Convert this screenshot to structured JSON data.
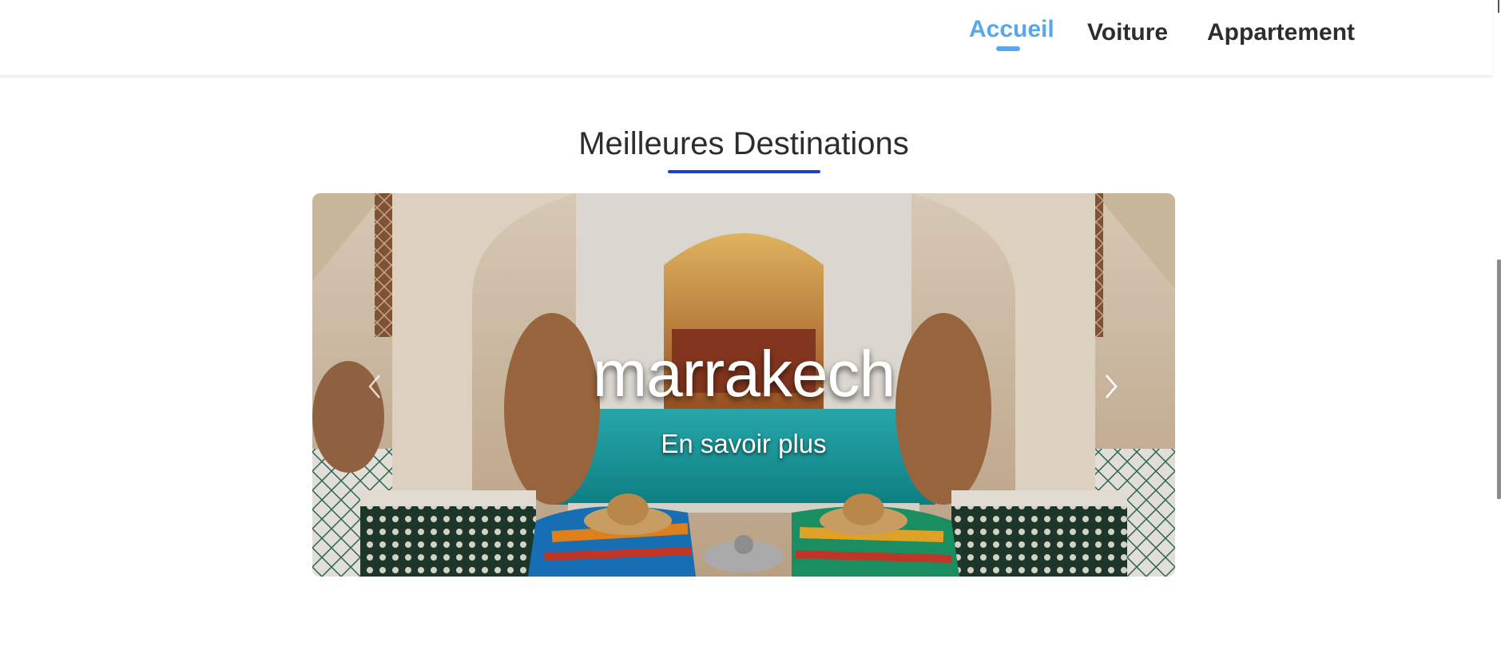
{
  "nav": {
    "items": [
      {
        "label": "Accueil",
        "active": true
      },
      {
        "label": "Voiture",
        "active": false
      },
      {
        "label": "Appartement",
        "active": false
      }
    ]
  },
  "section": {
    "title": "Meilleures Destinations"
  },
  "carousel": {
    "slide_title": "marrakech",
    "slide_link": "En savoir plus",
    "prev_icon": "chevron-left-icon",
    "next_icon": "chevron-right-icon"
  },
  "colors": {
    "accent": "#5aa6ea",
    "title_underline": "#1e3fd1",
    "text": "#2d2d2d"
  }
}
